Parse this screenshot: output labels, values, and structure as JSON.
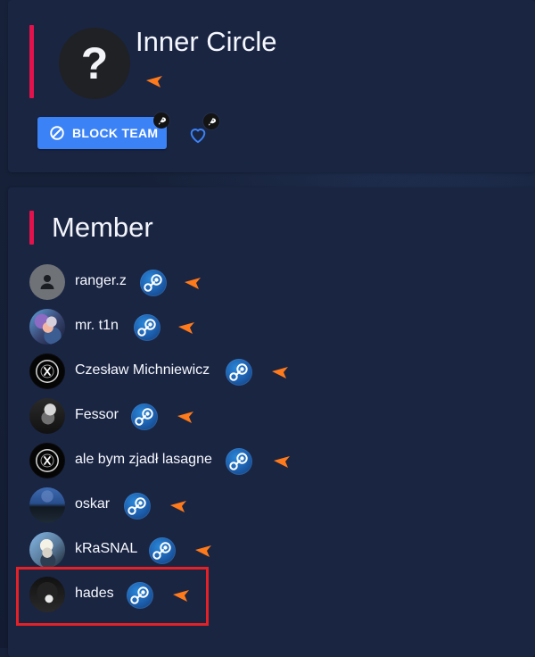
{
  "team": {
    "name": "Inner Circle",
    "avatar_text": "?",
    "block_button_label": "BLOCK TEAM"
  },
  "members_section": {
    "title": "Member",
    "members": [
      {
        "name": "ranger.z"
      },
      {
        "name": "mr. t1n"
      },
      {
        "name": "Czesław Michniewicz"
      },
      {
        "name": "Fessor"
      },
      {
        "name": "ale bym zjadł lasagne"
      },
      {
        "name": "oskar"
      },
      {
        "name": "kRaSNAL"
      },
      {
        "name": "hades"
      }
    ]
  },
  "icons": {
    "block": "block-icon",
    "heart": "heart-icon",
    "rocket_badge": "rocket-icon",
    "steam": "steam-icon",
    "flag": "flag-icon"
  },
  "colors": {
    "background": "#162038",
    "card": "#1a2542",
    "accent_bar": "#e3124d",
    "block_button": "#3b82f6",
    "flag": "#ff7a1a",
    "highlight": "#e32127",
    "heart": "#3b82f6"
  }
}
